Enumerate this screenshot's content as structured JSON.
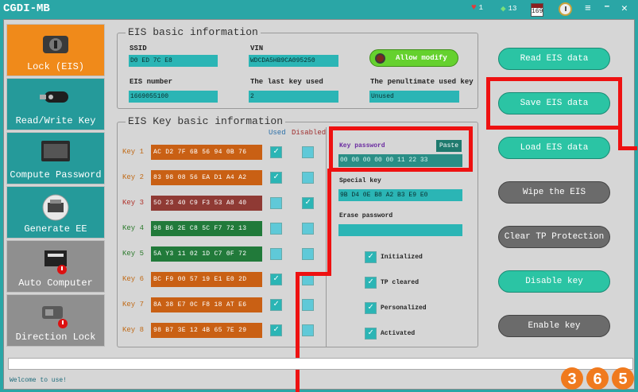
{
  "window": {
    "title": "CGDI-MB",
    "heart_count": "1",
    "gem_count": "13",
    "calendar_day": "169"
  },
  "sidebar": {
    "items": [
      {
        "label": "Lock (EIS)"
      },
      {
        "label": "Read/Write Key"
      },
      {
        "label": "Compute Password"
      },
      {
        "label": "Generate EE"
      },
      {
        "label": "Auto Computer"
      },
      {
        "label": "Direction Lock"
      }
    ]
  },
  "eis_basic": {
    "title": "EIS basic information",
    "ssid_label": "SSID",
    "ssid_value": "D0 ED 7C E8",
    "vin_label": "VIN",
    "vin_value": "WDCDA5HB9CA095250",
    "allow_modify": "Allow modify",
    "eis_number_label": "EIS number",
    "eis_number_value": "1669055100",
    "last_key_label": "The last key used",
    "last_key_value": "2",
    "penultimate_label": "The penultimate used key",
    "penultimate_value": "Unused"
  },
  "key_info": {
    "title": "EIS Key basic information",
    "used_header": "Used",
    "disabled_header": "Disabled",
    "keys": [
      {
        "label": "Key 1",
        "value": "AC D2 7F 6B 56 94 0B 76"
      },
      {
        "label": "Key 2",
        "value": "83 98 08 56 EA D1 A4 A2"
      },
      {
        "label": "Key 3",
        "value": "5O 23 40 C9 F3 53 A8 40"
      },
      {
        "label": "Key 4",
        "value": "98 B6 2E C8 5C F7 72 13"
      },
      {
        "label": "Key 5",
        "value": "5A Y3 11 02 1D C7 0F 72"
      },
      {
        "label": "Key 6",
        "value": "BC F9 00 57 19 E1 E0 2D"
      },
      {
        "label": "Key 7",
        "value": "8A 38 E7 0C F8 18 AT E6"
      },
      {
        "label": "Key 8",
        "value": "98 B7 3E 12 4B 65 7E 29"
      }
    ],
    "key_password_label": "Key password",
    "paste_label": "Paste",
    "key_password_value": "00 00 00 00 00 11 22 33",
    "special_key_label": "Special key",
    "special_key_value": "9B D4 0E B8 A2 B3 E9 E0",
    "erase_password_label": "Erase password",
    "erase_password_value": "",
    "status_checks": [
      {
        "label": "Initialized"
      },
      {
        "label": "TP cleared"
      },
      {
        "label": "Personalized"
      },
      {
        "label": "Activated"
      }
    ]
  },
  "actions": {
    "read_eis": "Read EIS data",
    "save_eis": "Save EIS data",
    "load_eis": "Load EIS data",
    "wipe_eis": "Wipe the EIS",
    "clear_tp": "Clear TP Protection",
    "disable_key": "Disable key",
    "enable_key": "Enable key"
  },
  "status": {
    "text": "Welcome to use!"
  },
  "colors": {
    "accent_teal": "#2aa6a6",
    "active_orange": "#f08a1a",
    "annotation_red": "#ee1111"
  },
  "icons": [
    "heart-icon",
    "gem-icon",
    "calendar-icon",
    "clock-icon",
    "menu-icon",
    "minimize-icon",
    "close-icon",
    "ignition-lock-icon",
    "car-key-icon",
    "keyboard-icon",
    "printer-icon",
    "ecu-icon",
    "steering-lock-icon",
    "check-icon"
  ]
}
